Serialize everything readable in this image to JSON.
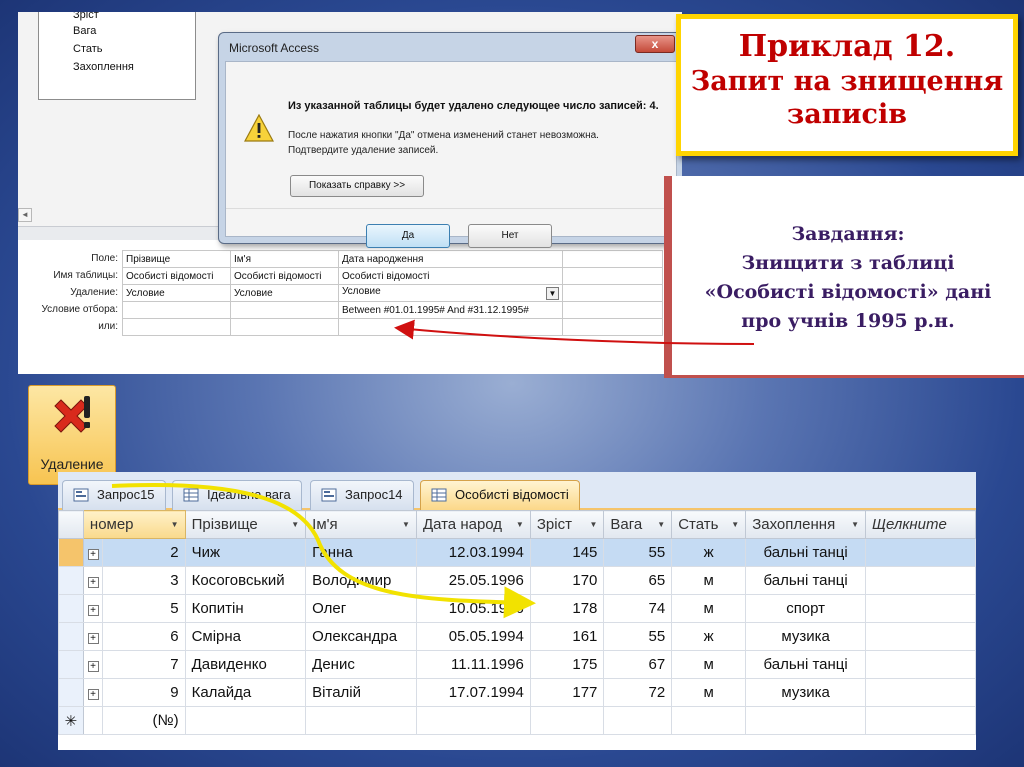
{
  "design_view": {
    "field_list": [
      "Зріст",
      "Вага",
      "Стать",
      "Захоплення"
    ],
    "row_labels": [
      "Поле:",
      "Имя таблицы:",
      "Удаление:",
      "Условие отбора:",
      "или:"
    ],
    "columns": [
      {
        "field": "Прізвище",
        "table": "Особисті відомості",
        "delete": "Условие",
        "criteria": ""
      },
      {
        "field": "Ім'я",
        "table": "Особисті відомості",
        "delete": "Условие",
        "criteria": ""
      },
      {
        "field": "Дата народження",
        "table": "Особисті відомості",
        "delete": "Условие",
        "criteria": "Between #01.01.1995# And #31.12.1995#"
      }
    ]
  },
  "dialog": {
    "title": "Microsoft Access",
    "close_label": "x",
    "message": "Из указанной таблицы будет удалено следующее число записей: 4.",
    "sub_line1": "После нажатия кнопки \"Да\" отмена изменений станет невозможна.",
    "sub_line2": "Подтвердите удаление записей.",
    "help_label": "Показать справку >>",
    "yes_label": "Да",
    "no_label": "Нет"
  },
  "title_box": {
    "line1": "Приклад 12.",
    "line2": "Запит на знищення",
    "line3": "записів"
  },
  "task_box": {
    "line1": "Завдання:",
    "line2": "Знищити з таблиці",
    "line3": "«Особисті відомості» дані",
    "line4": "про учнів 1995 р.н."
  },
  "delete_button": {
    "label": "Удаление",
    "icon": "delete-x-exclaim-icon"
  },
  "tabs": [
    {
      "label": "Запрос15",
      "icon": "query-icon"
    },
    {
      "label": "Ідеальна вага",
      "icon": "table-icon"
    },
    {
      "label": "Запрос14",
      "icon": "query-icon"
    },
    {
      "label": "Особисті відомості",
      "icon": "table-icon"
    }
  ],
  "datasheet": {
    "headers": [
      "номер",
      "Прізвище",
      "Ім'я",
      "Дата народ",
      "Зріст",
      "Вага",
      "Стать",
      "Захоплення",
      "Щелкните"
    ],
    "rows": [
      [
        "2",
        "Чиж",
        "Ганна",
        "12.03.1994",
        "145",
        "55",
        "ж",
        "бальні танці"
      ],
      [
        "3",
        "Косоговський",
        "Володимир",
        "25.05.1996",
        "170",
        "65",
        "м",
        "бальні танці"
      ],
      [
        "5",
        "Копитін",
        "Олег",
        "10.05.1996",
        "178",
        "74",
        "м",
        "спорт"
      ],
      [
        "6",
        "Смірна",
        "Олександра",
        "05.05.1994",
        "161",
        "55",
        "ж",
        "музика"
      ],
      [
        "7",
        "Давиденко",
        "Денис",
        "11.11.1996",
        "175",
        "67",
        "м",
        "бальні танці"
      ],
      [
        "9",
        "Калайда",
        "Віталій",
        "17.07.1994",
        "177",
        "72",
        "м",
        "музика"
      ]
    ],
    "new_row_label": "(№)",
    "new_row_marker": "✳",
    "expand_marker": "+"
  },
  "colors": {
    "title_text": "#c00000",
    "title_border": "#ffd400",
    "task_text": "#3a1d63",
    "arrow_red": "#d01010",
    "arrow_yellow": "#f2e200"
  }
}
